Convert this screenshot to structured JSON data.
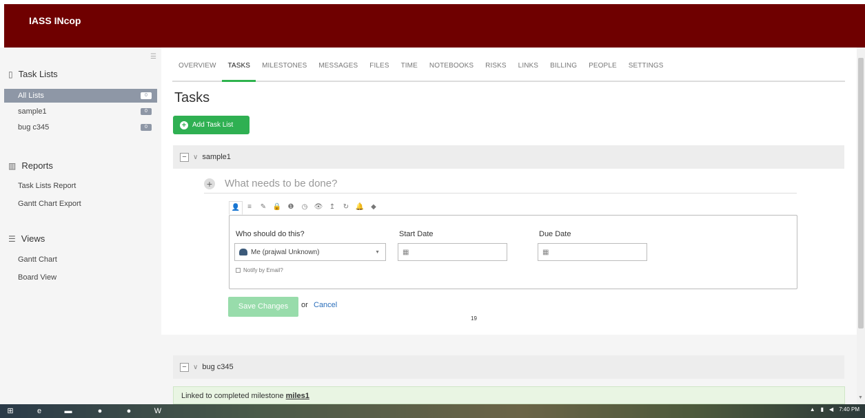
{
  "app": {
    "brand": "IASS INcop"
  },
  "sidebar": {
    "task_lists_title": "Task Lists",
    "lists": [
      {
        "label": "All Lists",
        "count": "0"
      },
      {
        "label": "sample1",
        "count": "0"
      },
      {
        "label": "bug c345",
        "count": "0"
      }
    ],
    "reports_title": "Reports",
    "reports": [
      "Task Lists Report",
      "Gantt Chart Export"
    ],
    "views_title": "Views",
    "views": [
      "Gantt Chart",
      "Board View"
    ]
  },
  "nav": {
    "tabs": [
      "OVERVIEW",
      "TASKS",
      "MILESTONES",
      "MESSAGES",
      "FILES",
      "TIME",
      "NOTEBOOKS",
      "RISKS",
      "LINKS",
      "BILLING",
      "PEOPLE",
      "SETTINGS"
    ],
    "active": "TASKS"
  },
  "main": {
    "title": "Tasks",
    "add_button": "Add Task List",
    "list1_name": "sample1",
    "task_placeholder": "What needs to be done?",
    "who_label": "Who should do this?",
    "assignee_value": "Me (prajwal Unknown)",
    "start_label": "Start Date",
    "due_label": "Due Date",
    "notify_label": "Notify by Email?",
    "save_button": "Save Changes",
    "or_text": "or",
    "cancel_link": "Cancel",
    "count_text": "19",
    "list2_name": "bug c345",
    "linked_text": "Linked to completed milestone",
    "milestone_link": "miles1"
  },
  "taskbar": {
    "time": "7:40 PM"
  },
  "colors": {
    "header": "#6f0000",
    "accent_green": "#2fb052",
    "active_item": "#8e97a6"
  }
}
